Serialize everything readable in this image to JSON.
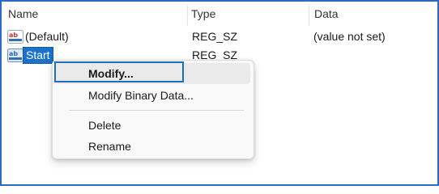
{
  "columns": {
    "name": "Name",
    "type": "Type",
    "data": "Data"
  },
  "rows": [
    {
      "name": "(Default)",
      "type": "REG_SZ",
      "data": "(value not set)",
      "icon": "string-value-icon",
      "selected": false
    },
    {
      "name": "Start",
      "type": "REG_SZ",
      "data": "",
      "icon": "string-value-icon",
      "selected": true
    }
  ],
  "context_menu": {
    "items": [
      {
        "label": "Modify...",
        "bold": true,
        "focused": true
      },
      {
        "label": "Modify Binary Data...",
        "bold": false,
        "focused": false
      },
      {
        "label": "Delete",
        "bold": false,
        "focused": false
      },
      {
        "label": "Rename",
        "bold": false,
        "focused": false
      }
    ]
  },
  "colors": {
    "selection": "#1a73c8",
    "focus_border": "#1f6fbf",
    "frame_border": "#2a6bbf",
    "icon_red": "#c0392b",
    "icon_blue": "#2f6fb6"
  }
}
